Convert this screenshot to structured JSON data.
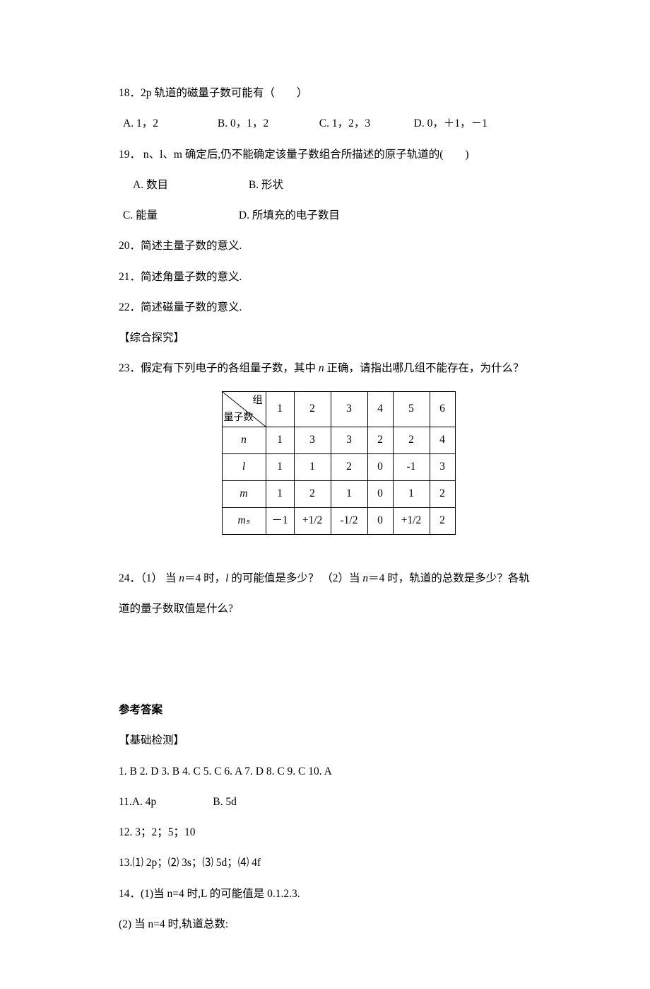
{
  "q18": {
    "stem": "18．2p 轨道的磁量子数可能有（　　）",
    "a": "A. 1，2",
    "b": "B. 0，1，2",
    "c": "C. 1，2，3",
    "d": "D. 0，＋1，－1"
  },
  "q19": {
    "stem": "19．  n、l、m 确定后,仍不能确定该量子数组合所描述的原子轨道的(　　)",
    "a": "A.  数目",
    "b": "B.  形状",
    "c": "C.  能量",
    "d": "D.  所填充的电子数目"
  },
  "q20": "20．简述主量子数的意义.",
  "q21": "21．简述角量子数的意义.",
  "q22": "22．简述磁量子数的意义.",
  "explore": "【综合探究】",
  "q23": {
    "pre": "23．假定有下列电子的各组量子数，其中 ",
    "mid": " 正确，请指出哪几组不能存在，为什么？",
    "n_var": "n"
  },
  "table": {
    "diag_top": "组",
    "diag_bot": "量子数",
    "cols": [
      "1",
      "2",
      "3",
      "4",
      "5",
      "6"
    ],
    "rows": [
      {
        "label": "n",
        "italic": true,
        "vals": [
          "1",
          "3",
          "3",
          "2",
          "2",
          "4"
        ]
      },
      {
        "label": "l",
        "italic": true,
        "vals": [
          "1",
          "1",
          "2",
          "0",
          "-1",
          "3"
        ]
      },
      {
        "label": "m",
        "italic": true,
        "vals": [
          "1",
          "2",
          "1",
          "0",
          "1",
          "2"
        ]
      },
      {
        "label": "mₛ",
        "italic": true,
        "vals": [
          "－1",
          "+1/2",
          "-1/2",
          "0",
          "+1/2",
          "2"
        ]
      }
    ]
  },
  "q24": {
    "p1a": "24．（1） 当 ",
    "p1b": "＝4 时，",
    "p1c": " 的可能值是多少？ （2）当 ",
    "p1d": "＝4 时，轨道的总数是多少？各轨",
    "n1": "n",
    "l1": "l",
    "n2": "n",
    "l2": "道的量子数取值是什么?"
  },
  "answers": {
    "title": "参考答案",
    "section": "【基础检测】",
    "a1": "1. B   2. D 3. B   4. C   5. C   6. A   7. D   8. C   9. C   10. A",
    "a11": "11.A. 4p",
    "a11b": "B. 5d",
    "a12": "12. 3；2；5；10",
    "a13": "13.⑴ 2p；⑵ 3s；⑶ 5d；⑷ 4f",
    "a14": "14．(1)当 n=4 时,L 的可能值是 0.1.2.3.",
    "a14b": "(2)  当 n=4 时,轨道总数:"
  }
}
